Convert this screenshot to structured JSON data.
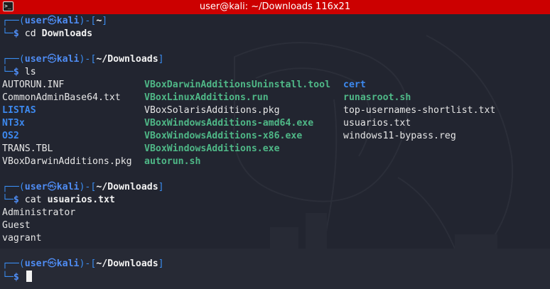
{
  "window": {
    "title": "user@kali: ~/Downloads 116x21",
    "icon": "terminal-icon",
    "icon_glyph": ">_"
  },
  "prompt": {
    "corner_top": "┌──(",
    "user": "user",
    "at_symbol": "㉿",
    "host": "kali",
    "mid": ")-[",
    "close": "]",
    "corner_bottom": "└─",
    "dollar": "$"
  },
  "blocks": [
    {
      "dir": "~",
      "command": "cd",
      "arg": "Downloads"
    },
    {
      "dir": "~/Downloads",
      "command": "ls",
      "arg": ""
    },
    {
      "dir": "~/Downloads",
      "command": "cat",
      "arg": "usuarios.txt"
    },
    {
      "dir": "~/Downloads",
      "command": "",
      "arg": ""
    }
  ],
  "ls_output": {
    "col1": [
      {
        "name": "AUTORUN.INF",
        "type": "normal"
      },
      {
        "name": "CommonAdminBase64.txt",
        "type": "normal"
      },
      {
        "name": "LISTAS",
        "type": "dir"
      },
      {
        "name": "NT3x",
        "type": "dir"
      },
      {
        "name": "OS2",
        "type": "dir"
      },
      {
        "name": "TRANS.TBL",
        "type": "normal"
      },
      {
        "name": "VBoxDarwinAdditions.pkg",
        "type": "normal"
      }
    ],
    "col2": [
      {
        "name": "VBoxDarwinAdditionsUninstall.tool",
        "type": "exec"
      },
      {
        "name": "VBoxLinuxAdditions.run",
        "type": "exec"
      },
      {
        "name": "VBoxSolarisAdditions.pkg",
        "type": "normal"
      },
      {
        "name": "VBoxWindowsAdditions-amd64.exe",
        "type": "exec"
      },
      {
        "name": "VBoxWindowsAdditions-x86.exe",
        "type": "exec"
      },
      {
        "name": "VBoxWindowsAdditions.exe",
        "type": "exec"
      },
      {
        "name": "autorun.sh",
        "type": "exec"
      }
    ],
    "col3": [
      {
        "name": "cert",
        "type": "dir"
      },
      {
        "name": "runasroot.sh",
        "type": "exec"
      },
      {
        "name": "top-usernames-shortlist.txt",
        "type": "normal"
      },
      {
        "name": "usuarios.txt",
        "type": "normal"
      },
      {
        "name": "windows11-bypass.reg",
        "type": "normal"
      }
    ]
  },
  "cat_output": [
    "Administrator",
    "Guest",
    "vagrant"
  ],
  "colors": {
    "titlebar": "#cc0000",
    "background": "#222530",
    "prompt_blue": "#3a8cf0",
    "dir_blue": "#3d89ef",
    "exec_green": "#4fb887",
    "text": "#e6e6e6"
  }
}
